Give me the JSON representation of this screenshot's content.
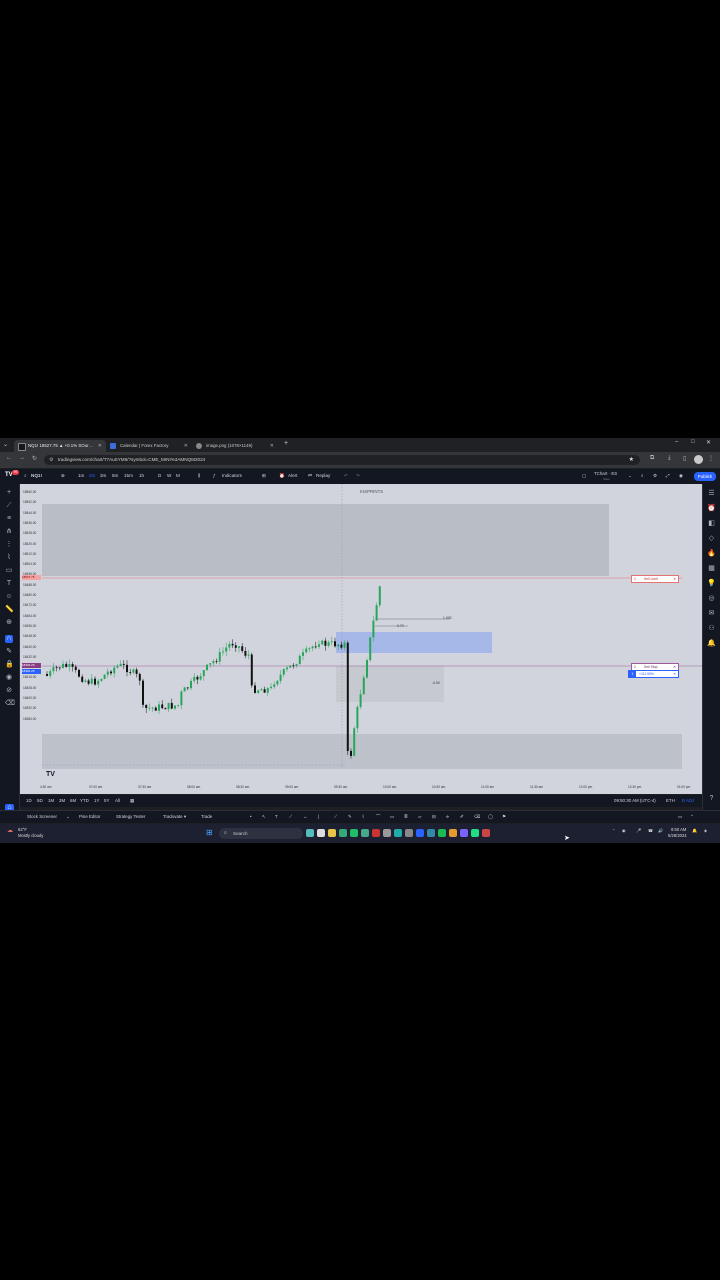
{
  "browser": {
    "tabs": [
      {
        "title": "NQ1! 18527.75 ▲ +0.1% SOur…",
        "active": true
      },
      {
        "title": "Calendar | Forex Factory",
        "active": false
      },
      {
        "title": "image.png (1076×1149)",
        "active": false
      }
    ],
    "new_tab": "+",
    "url": "tradingview.com/chart/T7AuSYM8/?symbol=CME_MINI%3AMNQM2024",
    "window_controls": [
      "–",
      "□",
      "✕"
    ]
  },
  "toolbar": {
    "symbol": "NQ1!",
    "intervals": [
      "1m",
      "2m",
      "3m",
      "5m",
      "15m",
      "1h",
      "D",
      "W",
      "M"
    ],
    "active_interval": "2m",
    "indicators": "Indicators",
    "alert": "Alert",
    "replay": "Replay",
    "layout_name": "TChart · ES",
    "layout_sub": "Save",
    "publish": "Publish",
    "notif_badge": "99"
  },
  "chart": {
    "watermark": "KISPRINTS",
    "logo": "TV",
    "y_labels": [
      "18560.00",
      "18552.00",
      "18544.00",
      "18536.00",
      "18528.00",
      "18520.00",
      "18512.00",
      "18504.00",
      "18496.00",
      "18488.00",
      "18480.00",
      "18472.00",
      "18464.00",
      "18456.00",
      "18448.00",
      "18440.00",
      "18432.00",
      "18424.00",
      "18416.00",
      "18408.00",
      "18400.00",
      "18392.00",
      "18384.00"
    ],
    "x_labels": [
      "4:30 am",
      "07:00 am",
      "07:30 am",
      "08:00 am",
      "08:30 am",
      "09:00 am",
      "09:30 am",
      "10:00 am",
      "10:30 am",
      "11:00 am",
      "11:30 am",
      "12:00 pm",
      "12:30 pm",
      "01:00 pm"
    ],
    "price_tags": {
      "current": "18527.75",
      "sell_level": "18492.25",
      "sell_level2": "18491.25"
    },
    "orders": {
      "sell_limit": "Sell Limit",
      "qty": "1",
      "sell_stop": "Sell Stop",
      "pnl": "+111.55%"
    },
    "annotations": [
      "1.000",
      "0.70",
      "-0.50",
      "1.00"
    ],
    "colors": {
      "background": "#d1d4dc",
      "up": "#26a65b",
      "down": "#111111",
      "zone": "#b8bcc6",
      "fvg": "#9fb6ea",
      "red_line": "#e57373",
      "purple_line": "#a05a9a"
    }
  },
  "bottombar": {
    "ranges": [
      "1D",
      "5D",
      "1M",
      "3M",
      "6M",
      "YTD",
      "1Y",
      "5Y",
      "All"
    ],
    "time": "09:50:30 AM (UTC-4)",
    "session": "ETH",
    "adj": "B ADJ"
  },
  "panels": [
    "Stock Screener",
    "Pine Editor",
    "Strategy Tester",
    "Tradovate ▾",
    "Trade"
  ],
  "taskbar": {
    "weather_temp": "62°F",
    "weather_text": "Mostly cloudy",
    "search": "Search",
    "clock_time": "9:50 AM",
    "clock_date": "5/28/2024"
  }
}
